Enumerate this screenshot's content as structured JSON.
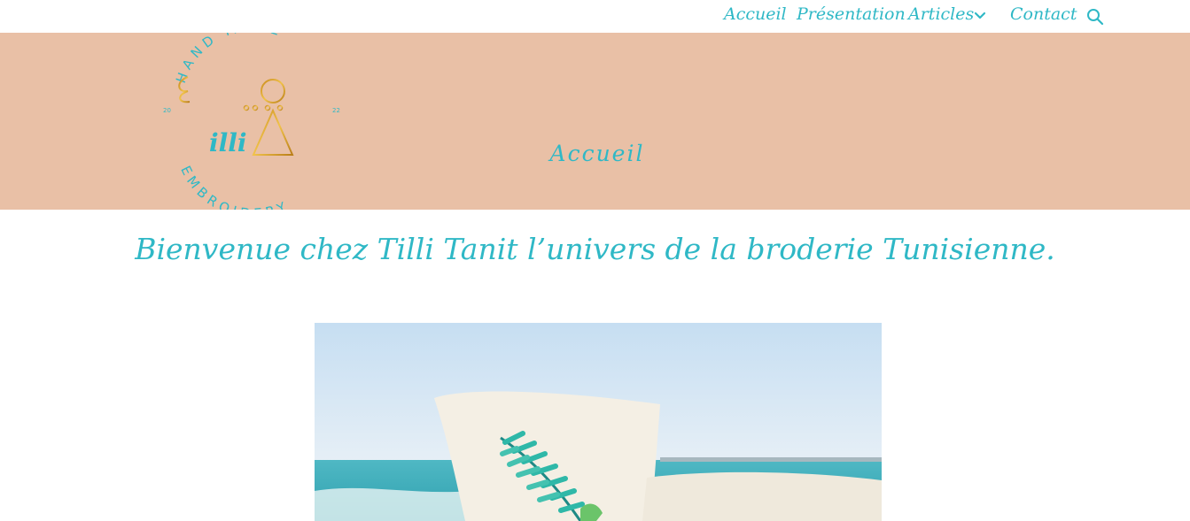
{
  "nav": {
    "items": [
      {
        "label": "Accueil"
      },
      {
        "label": "Présentation"
      },
      {
        "label": "Articles",
        "has_dropdown": true
      },
      {
        "label": "Contact"
      }
    ],
    "search_icon": "search-icon",
    "dropdown_icon": "chevron-down-icon"
  },
  "logo": {
    "top_text": "HAND MADE",
    "bottom_text": "EMBROIDERY",
    "year_left": "20",
    "year_right": "22",
    "brand_text": "illi"
  },
  "hero": {
    "title": "Accueil"
  },
  "main": {
    "welcome": "Bienvenue chez Tilli Tanit l’univers de la broderie Tunisienne."
  },
  "colors": {
    "accent": "#2fb8c6",
    "hero_bg": "#e9c0a6",
    "gold": "#d9a62a"
  }
}
